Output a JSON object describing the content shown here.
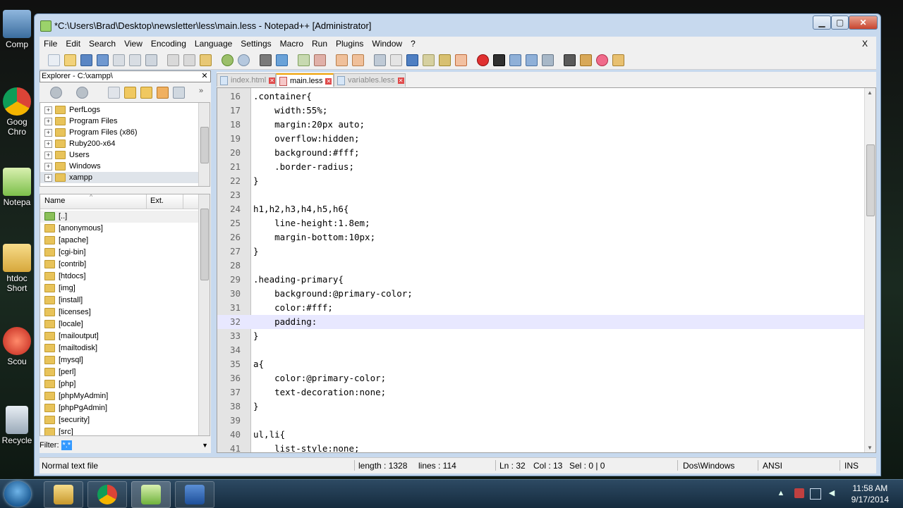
{
  "window": {
    "title": "*C:\\Users\\Brad\\Desktop\\newsletter\\less\\main.less - Notepad++ [Administrator]",
    "minimize": "▁",
    "maximize": "▢",
    "close": "✕"
  },
  "desktop_icons": [
    {
      "label": "Comp"
    },
    {
      "label": "Goog Chro"
    },
    {
      "label": "Notepa"
    },
    {
      "label": "htdoc Short"
    },
    {
      "label": "Scou"
    },
    {
      "label": "Recycle"
    }
  ],
  "menu": {
    "items": [
      "File",
      "Edit",
      "Search",
      "View",
      "Encoding",
      "Language",
      "Settings",
      "Macro",
      "Run",
      "Plugins",
      "Window",
      "?"
    ],
    "close": "X"
  },
  "explorer": {
    "title": "Explorer - C:\\xampp\\",
    "close": "✕",
    "tree": [
      "PerfLogs",
      "Program Files",
      "Program Files (x86)",
      "Ruby200-x64",
      "Users",
      "Windows",
      "xampp"
    ],
    "col_name": "Name",
    "col_ext": "Ext.",
    "files": [
      "[..]",
      "[anonymous]",
      "[apache]",
      "[cgi-bin]",
      "[contrib]",
      "[htdocs]",
      "[img]",
      "[install]",
      "[licenses]",
      "[locale]",
      "[mailoutput]",
      "[mailtodisk]",
      "[mysql]",
      "[perl]",
      "[php]",
      "[phpMyAdmin]",
      "[phpPgAdmin]",
      "[security]",
      "[src]"
    ],
    "filter_label": "Filter:",
    "filter_value": "*.*"
  },
  "tabs": [
    {
      "label": "index.html",
      "active": false
    },
    {
      "label": "main.less",
      "active": true
    },
    {
      "label": "variables.less",
      "active": false
    }
  ],
  "code": [
    {
      "n": "16",
      "t": ".container{"
    },
    {
      "n": "17",
      "t": "    width:55%;"
    },
    {
      "n": "18",
      "t": "    margin:20px auto;"
    },
    {
      "n": "19",
      "t": "    overflow:hidden;"
    },
    {
      "n": "20",
      "t": "    background:#fff;"
    },
    {
      "n": "21",
      "t": "    .border-radius;"
    },
    {
      "n": "22",
      "t": "}"
    },
    {
      "n": "23",
      "t": ""
    },
    {
      "n": "24",
      "t": "h1,h2,h3,h4,h5,h6{"
    },
    {
      "n": "25",
      "t": "    line-height:1.8em;"
    },
    {
      "n": "26",
      "t": "    margin-bottom:10px;"
    },
    {
      "n": "27",
      "t": "}"
    },
    {
      "n": "28",
      "t": ""
    },
    {
      "n": "29",
      "t": ".heading-primary{"
    },
    {
      "n": "30",
      "t": "    background:@primary-color;"
    },
    {
      "n": "31",
      "t": "    color:#fff;"
    },
    {
      "n": "32",
      "t": "    padding:"
    },
    {
      "n": "33",
      "t": "}"
    },
    {
      "n": "34",
      "t": ""
    },
    {
      "n": "35",
      "t": "a{"
    },
    {
      "n": "36",
      "t": "    color:@primary-color;"
    },
    {
      "n": "37",
      "t": "    text-decoration:none;"
    },
    {
      "n": "38",
      "t": "}"
    },
    {
      "n": "39",
      "t": ""
    },
    {
      "n": "40",
      "t": "ul,li{"
    },
    {
      "n": "41",
      "t": "    list-style:none;"
    }
  ],
  "current_line": "32",
  "status": {
    "type": "Normal text file",
    "length": "length : 1328",
    "lines": "lines : 114",
    "ln": "Ln : 32",
    "col": "Col : 13",
    "sel": "Sel : 0 | 0",
    "eol": "Dos\\Windows",
    "enc": "ANSI",
    "mode": "INS"
  },
  "clock": {
    "time": "11:58 AM",
    "date": "9/17/2014"
  },
  "colors": {
    "accent": "#f0a000",
    "current_line": "#e8e8ff",
    "selection": "#3399ff"
  }
}
